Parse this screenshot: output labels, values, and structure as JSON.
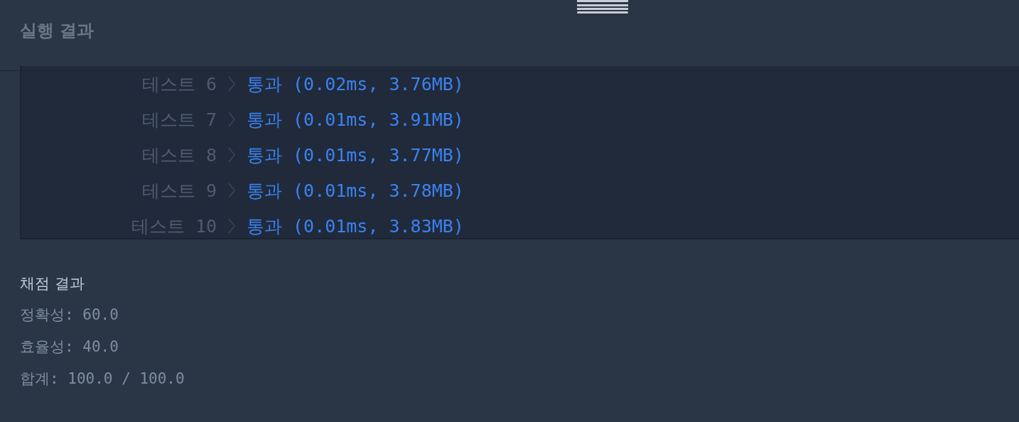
{
  "header": {
    "title": "실행 결과"
  },
  "tests": [
    {
      "label": "테스트 6",
      "result": "통과 (0.02ms, 3.76MB)"
    },
    {
      "label": "테스트 7",
      "result": "통과 (0.01ms, 3.91MB)"
    },
    {
      "label": "테스트 8",
      "result": "통과 (0.01ms, 3.77MB)"
    },
    {
      "label": "테스트 9",
      "result": "통과 (0.01ms, 3.78MB)"
    },
    {
      "label": "테스트 10",
      "result": "통과 (0.01ms, 3.83MB)"
    }
  ],
  "grading": {
    "title": "채점 결과",
    "lines": [
      "정확성: 60.0",
      "효율성: 40.0",
      "합계: 100.0 / 100.0"
    ]
  }
}
